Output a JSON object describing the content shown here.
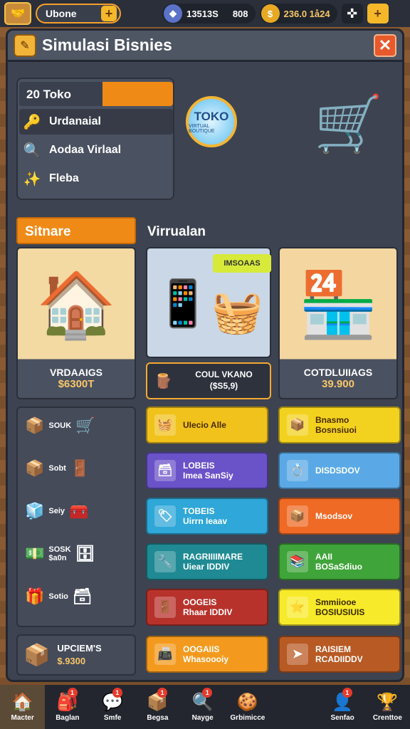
{
  "hud": {
    "player_name": "Ubone",
    "resource_1": "13513S",
    "resource_2": "808",
    "gold": "236.0 1å24",
    "icons": {
      "avatar": "handshake-icon",
      "gem": "gem-icon",
      "gold": "gold-coin-icon",
      "settings": "gamepad-icon"
    }
  },
  "panel": {
    "title": "Simulasi Bisnies",
    "close_label": "✕"
  },
  "stats": {
    "toko_count": "20 Toko",
    "progress": 0.46,
    "rows": [
      {
        "label": "Urdanaial",
        "icon": "key-icon"
      },
      {
        "label": "Aodaa Virlaal",
        "icon": "magnifier-icon"
      },
      {
        "label": "Fleba",
        "icon": "sparkle-icon"
      }
    ]
  },
  "toko_badge": {
    "title": "TOKO",
    "subtitle": "VIRTUAL BOUTIQUE"
  },
  "sections": {
    "left_tab": "Sitnare",
    "right_title": "Virrualan"
  },
  "cards": {
    "left": {
      "name": "VRDAAIGS",
      "price": "$6300T"
    },
    "mid": {
      "badge": "IMSOAAS",
      "name": "COUL VKANO",
      "price": "($S5,9)"
    },
    "right": {
      "name": "COTDLUIIAGS",
      "price": "39.900"
    }
  },
  "left_list": [
    {
      "label": "SOUK",
      "icon": "crates-icon"
    },
    {
      "label": "Sobt",
      "icon": "box-icon"
    },
    {
      "label": "Seiy",
      "icon": "cube-icon"
    },
    {
      "label": "SOSK\n$a0n",
      "icon": "package-icon"
    },
    {
      "label": "Sotio",
      "icon": "gift-icon"
    }
  ],
  "buttons": [
    {
      "line1": "UIecio Alle",
      "line2": "",
      "color": "#f1c21b",
      "text_color": "#4a2c00",
      "icon": "basket-icon"
    },
    {
      "line1": "Bnasmo",
      "line2": "Bosnsiuoi",
      "color": "#f3d21f",
      "text_color": "#4a2c00",
      "icon": "box-icon"
    },
    {
      "line1": "LOBEIS",
      "line2": "Imea SanSiy",
      "color": "#6a52c9",
      "text_color": "#ffffff",
      "icon": "crate-icon"
    },
    {
      "line1": "DISDSDOV",
      "line2": "",
      "color": "#5aa9e6",
      "text_color": "#ffffff",
      "icon": "ring-icon"
    },
    {
      "line1": "TOBEIS",
      "line2": "Uirrn Ieaav",
      "color": "#2fa7d8",
      "text_color": "#ffffff",
      "icon": "tag-icon"
    },
    {
      "line1": "Msodsov",
      "line2": "",
      "color": "#ef6a25",
      "text_color": "#ffffff",
      "icon": "box-icon"
    },
    {
      "line1": "RAGRIIIIMARE",
      "line2": "Uiear IDDIV",
      "color": "#1f8a93",
      "text_color": "#ffffff",
      "icon": "tool-icon"
    },
    {
      "line1": "AAII",
      "line2": "BOSaSdiuo",
      "color": "#3fa43a",
      "text_color": "#ffffff",
      "icon": "stack-icon"
    },
    {
      "line1": "OOGEIS",
      "line2": "Rhaar IDDIV",
      "color": "#b8322c",
      "text_color": "#ffffff",
      "icon": "door-icon"
    },
    {
      "line1": "Smmiiooe",
      "line2": "BOSIUSIUIS",
      "color": "#f7ea2a",
      "text_color": "#3a2a00",
      "icon": "star-icon"
    },
    {
      "line1": "OOGAIIS",
      "line2": "Whasoooiy",
      "color": "#f39a1e",
      "text_color": "#ffffff",
      "icon": "scanner-icon"
    },
    {
      "line1": "RAISIEM",
      "line2": "RCADIIDDV",
      "color": "#b85a24",
      "text_color": "#ffffff",
      "icon": "arrow-icon"
    }
  ],
  "upgrade": {
    "title": "UPCIEM'S",
    "price": "$.9300",
    "icon": "box-icon"
  },
  "nav": [
    {
      "label": "Macter",
      "icon": "home-icon",
      "badge": ""
    },
    {
      "label": "Baglan",
      "icon": "bag-icon",
      "badge": "1"
    },
    {
      "label": "Smfe",
      "icon": "chat-icon",
      "badge": "1"
    },
    {
      "label": "Begsa",
      "icon": "box-icon",
      "badge": "1"
    },
    {
      "label": "Nayge",
      "icon": "search-icon",
      "badge": "1"
    },
    {
      "label": "Grbimicce",
      "icon": "cookie-icon",
      "badge": ""
    },
    {
      "label": "Senfao",
      "icon": "profile-icon",
      "badge": "1"
    },
    {
      "label": "Crenttoe",
      "icon": "trophy-icon",
      "badge": ""
    }
  ],
  "colors": {
    "accent": "#f08a17",
    "panel": "#3d4350",
    "gold": "#f7c66a"
  }
}
